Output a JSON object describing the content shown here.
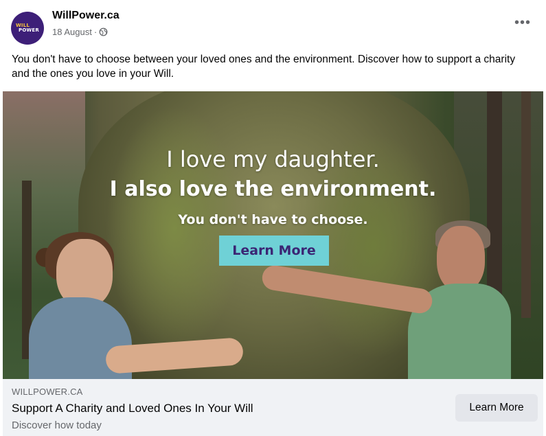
{
  "post": {
    "page_name": "WillPower.ca",
    "avatar_text_top": "WILL",
    "avatar_text_bottom": "POWER",
    "date": "18 August",
    "separator": "·",
    "more_label": "•••",
    "caption": "You don't have to choose between your loved ones and the environment. Discover how to support a charity and the ones you love in your Will."
  },
  "ad_image": {
    "line1": "I love my daughter.",
    "line2": "I also love the environment.",
    "line3": "You don't have to choose.",
    "cta": "Learn More"
  },
  "link_card": {
    "domain": "WILLPOWER.CA",
    "headline": "Support A Charity and Loved Ones In Your Will",
    "description": "Discover how today",
    "cta": "Learn More"
  },
  "icons": {
    "privacy": "globe-icon",
    "more": "more-options-icon"
  },
  "colors": {
    "brand_purple": "#3d1f78",
    "cta_teal": "#6fd1d6",
    "cta_text": "#3b2574",
    "card_bg": "#f0f2f5"
  }
}
